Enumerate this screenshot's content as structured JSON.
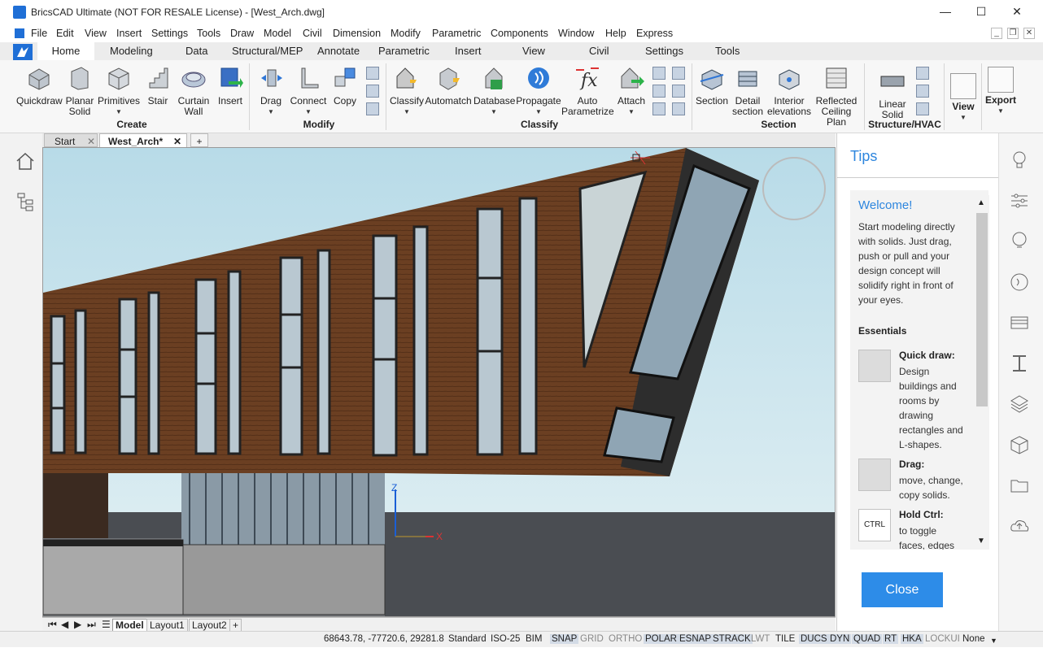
{
  "window": {
    "title": "BricsCAD Ultimate (NOT FOR RESALE License) - [West_Arch.dwg]",
    "minimize": "—",
    "maximize": "☐",
    "close": "✕"
  },
  "menu": [
    "File",
    "Edit",
    "View",
    "Insert",
    "Settings",
    "Tools",
    "Draw",
    "Model",
    "Civil",
    "Dimension",
    "Modify",
    "Parametric",
    "Components",
    "Window",
    "Help",
    "Express"
  ],
  "ribbon_tabs": [
    "Home",
    "Modeling",
    "Data",
    "Structural/MEP",
    "Annotate",
    "Parametric",
    "Insert",
    "View",
    "Civil",
    "Settings",
    "Tools"
  ],
  "active_tab": "Home",
  "ribbon": {
    "create": {
      "label": "Create",
      "buttons": [
        "Quickdraw",
        "Planar\nSolid",
        "Primitives",
        "Stair",
        "Curtain\nWall",
        "Insert"
      ]
    },
    "modify": {
      "label": "Modify",
      "buttons": [
        "Drag",
        "Connect",
        "Copy"
      ]
    },
    "classify": {
      "label": "Classify",
      "buttons": [
        "Classify",
        "Automatch",
        "Database",
        "Propagate",
        "Auto\nParametrize",
        "Attach"
      ]
    },
    "section": {
      "label": "Section",
      "buttons": [
        "Section",
        "Detail\nsection",
        "Interior\nelevations",
        "Reflected\nCeiling Plan"
      ]
    },
    "structure": {
      "label": "Structure/HVAC",
      "buttons": [
        "Linear\nSolid"
      ]
    },
    "view": {
      "label": "View"
    },
    "export": {
      "label": "Export"
    }
  },
  "doc_tabs": [
    {
      "label": "Start"
    },
    {
      "label": "West_Arch*"
    }
  ],
  "layout_tabs": [
    "Model",
    "Layout1",
    "Layout2",
    "+"
  ],
  "axis_labels": {
    "z": "Z",
    "x": "X"
  },
  "tips": {
    "header": "Tips",
    "welcome": "Welcome!",
    "intro": [
      "Start modeling directly",
      "with solids. Just drag,",
      "push or pull and your",
      "design concept will",
      "solidify right in front of",
      "your eyes."
    ],
    "essentials": "Essentials",
    "items": [
      {
        "title": "Quick draw:",
        "text": [
          "Design",
          "buildings and",
          "rooms by",
          "drawing",
          "rectangles and",
          "L-shapes."
        ],
        "icon": "quickdraw-icon"
      },
      {
        "title": "Drag:",
        "text": [
          "move, change,",
          "copy solids."
        ],
        "icon": "drag-icon"
      },
      {
        "title": "Hold Ctrl:",
        "text": [
          "to toggle",
          "faces, edges"
        ],
        "icon": "ctrl-key-icon",
        "key": "CTRL"
      }
    ],
    "close": "Close"
  },
  "status": {
    "coords": "68643.78, -77720.6, 29281.8",
    "items": [
      {
        "t": "Standard",
        "s": "n"
      },
      {
        "t": "ISO-25",
        "s": "n"
      },
      {
        "t": "BIM",
        "s": "n"
      },
      {
        "t": "SNAP",
        "s": "on"
      },
      {
        "t": "GRID",
        "s": "off"
      },
      {
        "t": "ORTHO",
        "s": "off"
      },
      {
        "t": "POLAR",
        "s": "on"
      },
      {
        "t": "ESNAP",
        "s": "on"
      },
      {
        "t": "STRACK",
        "s": "on"
      },
      {
        "t": "LWT",
        "s": "off"
      },
      {
        "t": "TILE",
        "s": "n"
      },
      {
        "t": "DUCS",
        "s": "on"
      },
      {
        "t": "DYN",
        "s": "on"
      },
      {
        "t": "QUAD",
        "s": "on"
      },
      {
        "t": "RT",
        "s": "on"
      },
      {
        "t": "HKA",
        "s": "on"
      },
      {
        "t": "LOCKUI",
        "s": "off"
      },
      {
        "t": "None",
        "s": "n"
      }
    ]
  },
  "colors": {
    "accent": "#2e86de",
    "facade": "#6b3f22",
    "sky": "#c7e4ef",
    "ground": "#4a4d52"
  }
}
